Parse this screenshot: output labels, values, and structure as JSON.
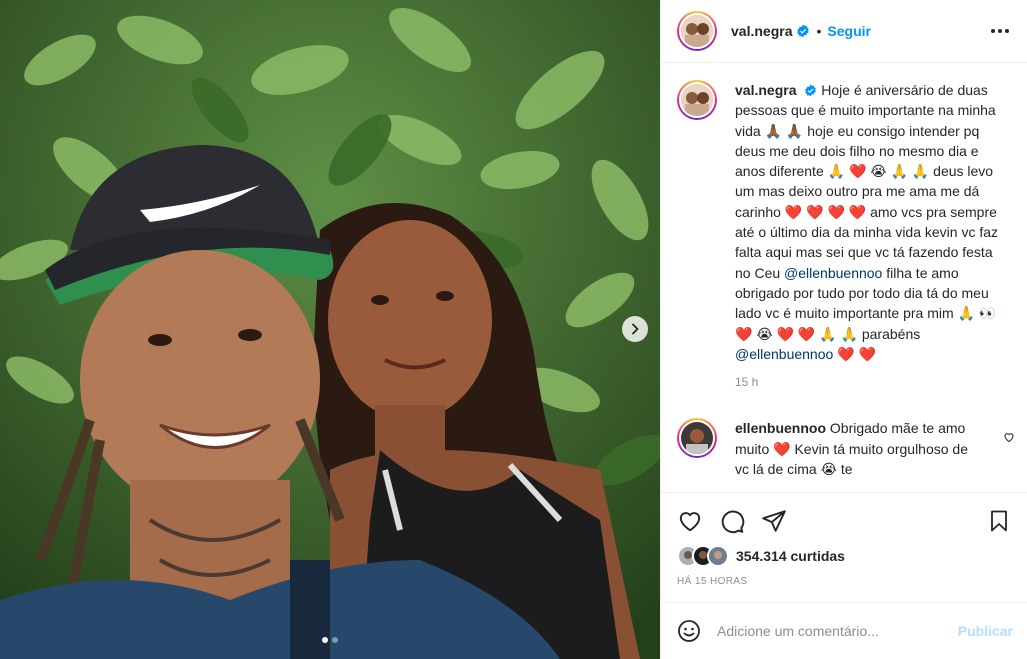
{
  "post": {
    "username": "val.negra",
    "follow_label": "Seguir",
    "separator": "•",
    "verified": true
  },
  "caption": {
    "username": "val.negra",
    "parts": [
      "Hoje é aniversário de duas pessoas que é muito importante na minha vida 🙏🏾 🙏🏾 hoje eu consigo intender pq deus me deu dois filho no mesmo dia e anos diferente 🙏 ❤️ 😭 🙏 🙏 deus levo um mas deixo outro pra me ama me dá carinho ❤️ ❤️ ❤️ ❤️ amo vcs pra sempre até o último dia da minha vida kevin vc faz falta aqui mas sei que vc tá fazendo festa no Ceu ",
      "@ellenbuennoo",
      " filha te amo obrigado por tudo por todo dia tá do meu lado vc é muito importante pra mim 🙏 👀 ❤️ 😭 ❤️ ❤️ 🙏 🙏 parabéns ",
      "@ellenbuennoo",
      " ❤️ ❤️"
    ],
    "time": "15 h"
  },
  "comment": {
    "username": "ellenbuennoo",
    "text": "Obrigado mãe te amo muito ❤️ Kevin tá muito orgulhoso de vc lá de cima 😭 te"
  },
  "likes": {
    "count": "354.314",
    "label": "curtidas",
    "ago": "HÁ 15 HORAS"
  },
  "composer": {
    "placeholder": "Adicione um comentário...",
    "publish_label": "Publicar"
  },
  "colors": {
    "link": "#0095f6",
    "mention": "#00376b",
    "publish_disabled": "#b2dffc",
    "muted": "#8e8e8e"
  },
  "icons": [
    "verified-icon",
    "more-icon",
    "heart-icon",
    "comment-icon",
    "share-icon",
    "bookmark-icon",
    "emoji-icon",
    "chevron-right-icon"
  ],
  "carousel": {
    "current": 1,
    "total": 2
  }
}
